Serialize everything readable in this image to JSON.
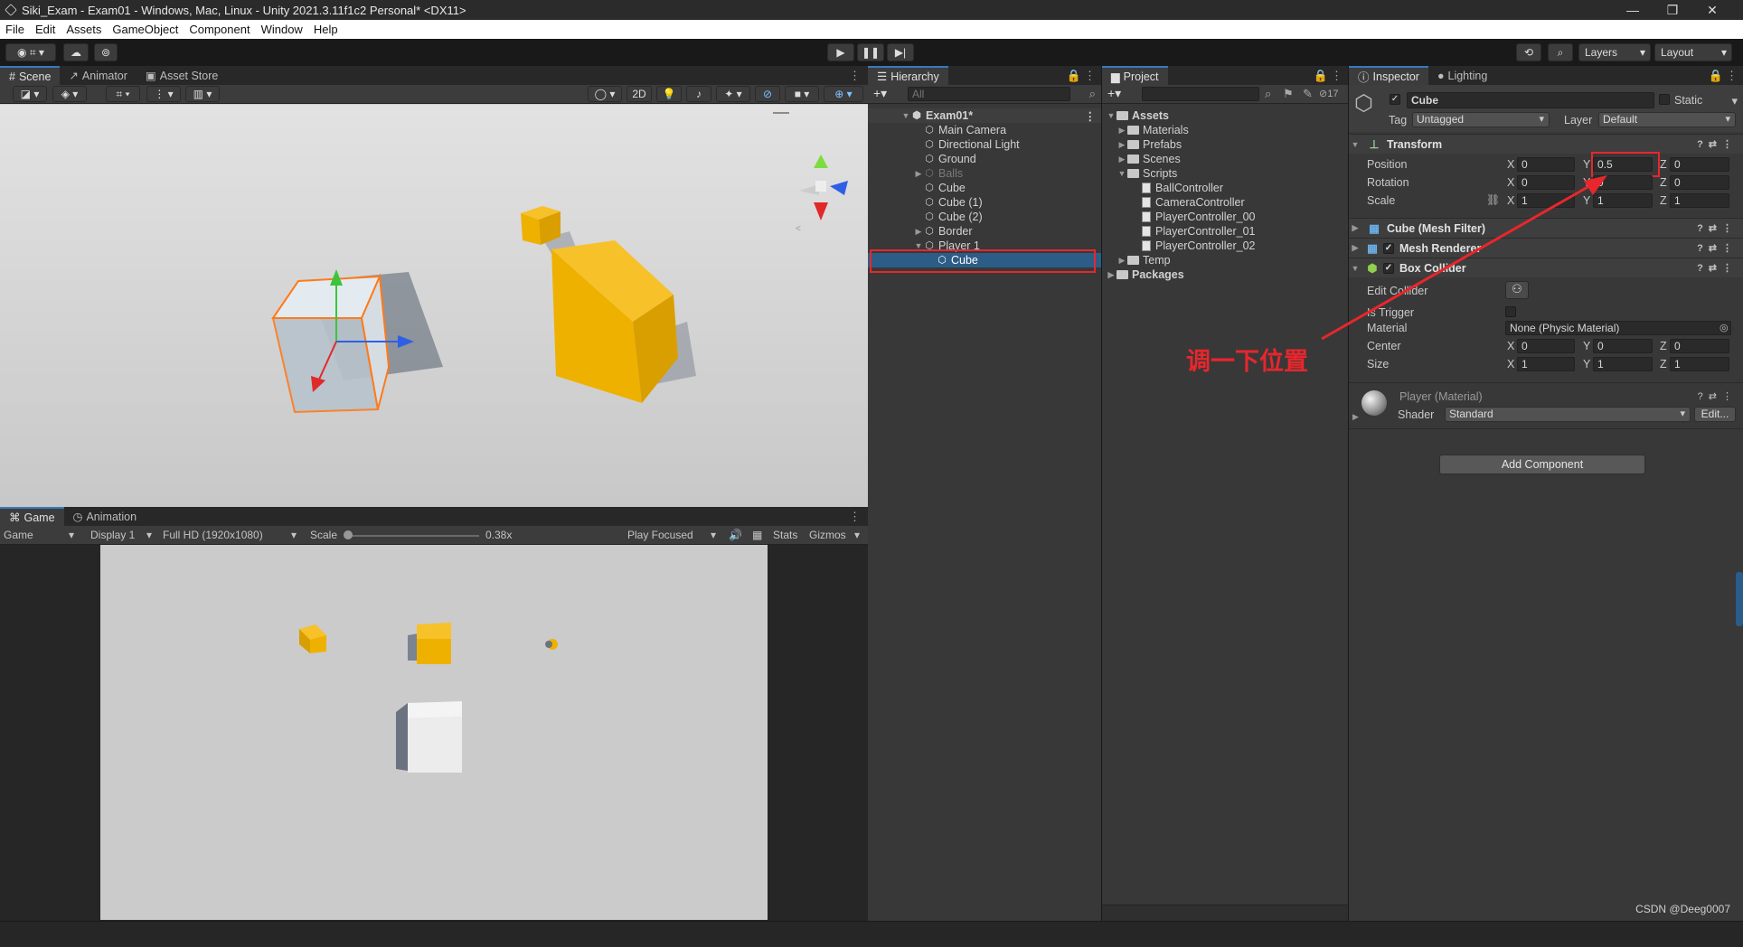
{
  "window": {
    "title": "Siki_Exam - Exam01 - Windows, Mac, Linux - Unity 2021.3.11f1c2 Personal* <DX11>"
  },
  "menu": [
    "File",
    "Edit",
    "Assets",
    "GameObject",
    "Component",
    "Window",
    "Help"
  ],
  "toolbar": {
    "layers": "Layers",
    "layout": "Layout"
  },
  "scene_tabs": [
    "Scene",
    "Animator",
    "Asset Store"
  ],
  "scene_toolbar": {
    "two_d": "2D"
  },
  "game_tabs": [
    "Game",
    "Animation"
  ],
  "game_bar": {
    "mode": "Game",
    "display": "Display 1",
    "resolution": "Full HD (1920x1080)",
    "scale_label": "Scale",
    "scale_value": "0.38x",
    "play_focused": "Play Focused",
    "stats": "Stats",
    "gizmos": "Gizmos",
    "scale_fraction": 0.02
  },
  "hierarchy": {
    "tab": "Hierarchy",
    "search_placeholder": "All",
    "items": [
      {
        "label": "Exam01*"
      },
      {
        "label": "Main Camera"
      },
      {
        "label": "Directional Light"
      },
      {
        "label": "Ground"
      },
      {
        "label": "Balls"
      },
      {
        "label": "Cube"
      },
      {
        "label": "Cube (1)"
      },
      {
        "label": "Cube (2)"
      },
      {
        "label": "Border"
      },
      {
        "label": "Player 1"
      },
      {
        "label": "Cube"
      }
    ]
  },
  "project": {
    "tab": "Project",
    "hidden_count": "17",
    "items": [
      {
        "label": "Assets"
      },
      {
        "label": "Materials"
      },
      {
        "label": "Prefabs"
      },
      {
        "label": "Scenes"
      },
      {
        "label": "Scripts"
      },
      {
        "label": "BallController"
      },
      {
        "label": "CameraController"
      },
      {
        "label": "PlayerController_00"
      },
      {
        "label": "PlayerController_01"
      },
      {
        "label": "PlayerController_02"
      },
      {
        "label": "Temp"
      },
      {
        "label": "Packages"
      }
    ]
  },
  "inspector": {
    "tabs": [
      "Inspector",
      "Lighting"
    ],
    "object_name": "Cube",
    "static_label": "Static",
    "tag_label": "Tag",
    "tag_value": "Untagged",
    "layer_label": "Layer",
    "layer_value": "Default",
    "transform": {
      "title": "Transform",
      "position_label": "Position",
      "position": {
        "x": "0",
        "y": "0.5",
        "z": "0"
      },
      "rotation_label": "Rotation",
      "rotation": {
        "x": "0",
        "y": "0",
        "z": "0"
      },
      "scale_label": "Scale",
      "scale": {
        "x": "1",
        "y": "1",
        "z": "1"
      }
    },
    "mesh_filter": "Cube (Mesh Filter)",
    "mesh_renderer": "Mesh Renderer",
    "box_collider": {
      "title": "Box Collider",
      "edit_collider": "Edit Collider",
      "is_trigger": "Is Trigger",
      "material_label": "Material",
      "material_value": "None (Physic Material)",
      "center_label": "Center",
      "center": {
        "x": "0",
        "y": "0",
        "z": "0"
      },
      "size_label": "Size",
      "size": {
        "x": "1",
        "y": "1",
        "z": "1"
      }
    },
    "material": {
      "name": "Player (Material)",
      "shader_label": "Shader",
      "shader_value": "Standard",
      "edit": "Edit..."
    },
    "add_component": "Add Component",
    "axis": {
      "x": "X",
      "y": "Y",
      "z": "Z"
    }
  },
  "annotation": {
    "text": "调一下位置",
    "color": "#e8262d"
  },
  "watermark": "CSDN @Deeg0007",
  "colors": {
    "selection": "#2c5d87",
    "accent": "#3a79bb",
    "cube": "#f0b400"
  }
}
